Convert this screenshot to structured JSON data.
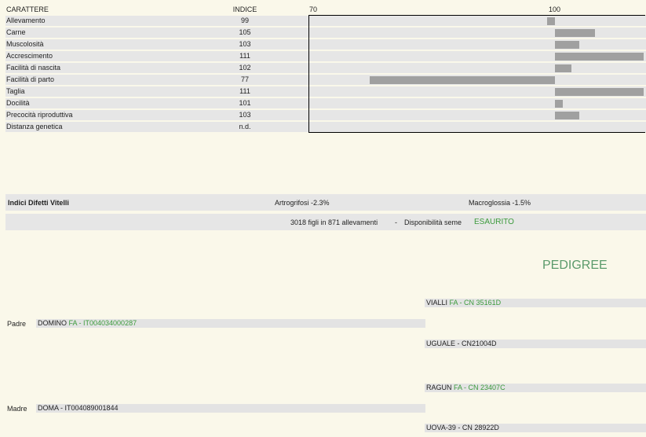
{
  "header": {
    "col_trait": "CARATTERE",
    "col_index": "INDICE",
    "scale_min": "70",
    "scale_mid": "100"
  },
  "chart_data": {
    "type": "bar",
    "baseline": 100,
    "xlim": [
      70,
      111
    ],
    "categories": [
      "Allevamento",
      "Carne",
      "Muscolosità",
      "Accrescimento",
      "Facilità di nascita",
      "Facilità di parto",
      "Taglia",
      "Docilità",
      "Precocità riproduttiva",
      "Distanza genetica"
    ],
    "values": [
      99,
      105,
      103,
      111,
      102,
      77,
      111,
      101,
      103,
      null
    ],
    "labels": [
      "99",
      "105",
      "103",
      "111",
      "102",
      "77",
      "111",
      "101",
      "103",
      "n.d."
    ]
  },
  "defects": {
    "title": "Indici Difetti Vitelli",
    "artro": "Artrogrifosi -2.3%",
    "macro": "Macroglossia -1.5%"
  },
  "summary": {
    "text": "3018 figli in 871 allevamenti",
    "sep": "-",
    "avail_label": "Disponibilità seme",
    "avail_value": "ESAURITO"
  },
  "pedigree": {
    "title": "PEDIGREE",
    "sire_label": "Padre",
    "sire_name": "DOMINO",
    "sire_code": "FA - IT004034000287",
    "dam_label": "Madre",
    "dam_name": "DOMA - IT004089001844",
    "gs1_name": "VIALLI",
    "gs1_code": "FA - CN 35161D",
    "gd1": "UGUALE - CN21004D",
    "gs2_name": "RAGUN",
    "gs2_code": "FA - CN 23407C",
    "gd2": "UOVA-39 - CN 28922D"
  }
}
